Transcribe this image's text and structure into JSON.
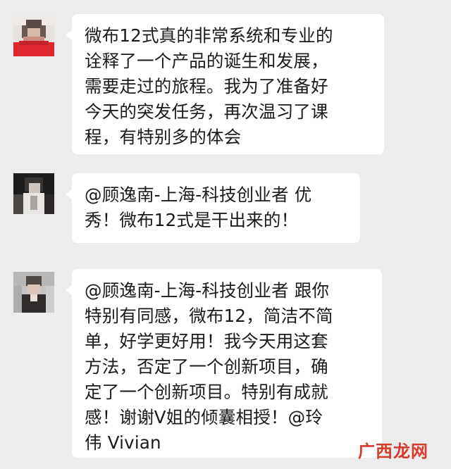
{
  "messages": [
    {
      "text": "微布12式真的非常系统和专业的\n诠释了一个产品的诞生和发展，\n需要走过的旅程。我为了准备好\n今天的突发任务，再次温习了课\n程，有特别多的体会"
    },
    {
      "text": "@顾逸南-上海-科技创业者 优\n秀！微布12式是干出来的！"
    },
    {
      "text": "@顾逸南-上海-科技创业者 跟你\n特别有同感，微布12，简洁不简\n单，好学更好用！我今天用这套\n方法，否定了一个创新项目，确\n定了一个创新项目。特别有成就\n感！谢谢V姐的倾囊相授！@玲\n伟 Vivian"
    }
  ],
  "watermark": {
    "text": "广西龙网",
    "color": "#d63b2c"
  },
  "colors": {
    "background": "#ececec",
    "bubble": "#ffffff",
    "text": "#1a1a1a"
  }
}
